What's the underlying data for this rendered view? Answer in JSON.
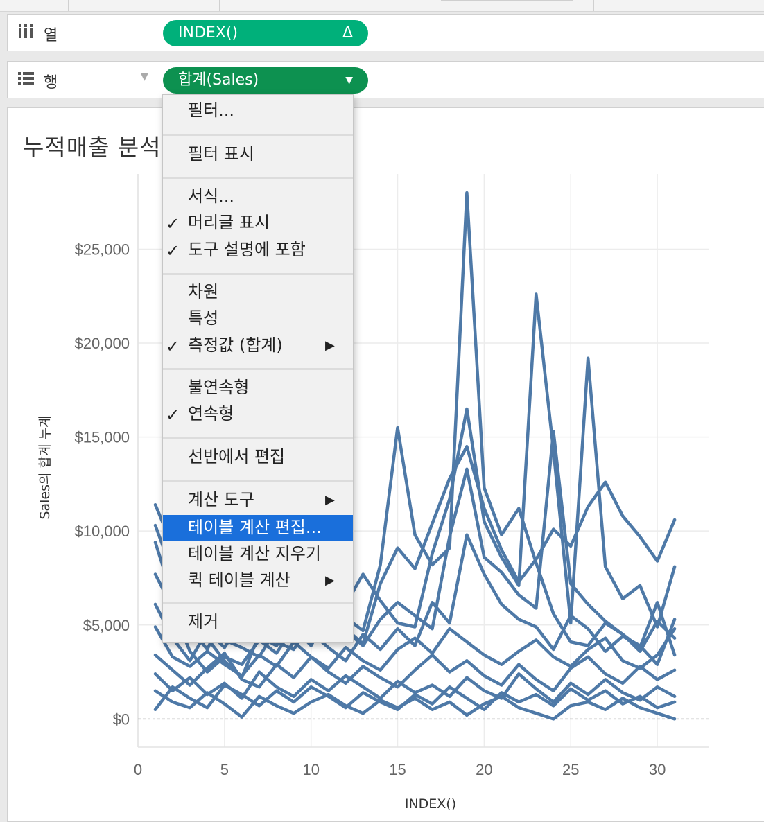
{
  "shelves": {
    "columns": {
      "label": "열",
      "pill": "INDEX()",
      "pill_symbol": "Δ",
      "icon": "columns-icon"
    },
    "rows": {
      "label": "행",
      "pill": "합계(Sales)",
      "pill_symbol": "▼",
      "icon": "rows-list-icon"
    }
  },
  "view": {
    "title": "누적매출 분석"
  },
  "menu": {
    "items": [
      {
        "label": "필터...",
        "checked": false,
        "submenu": false
      },
      {
        "label": "필터 표시",
        "checked": false,
        "submenu": false
      },
      {
        "label": "서식...",
        "checked": false,
        "submenu": false
      },
      {
        "label": "머리글 표시",
        "checked": true,
        "submenu": false
      },
      {
        "label": "도구 설명에 포함",
        "checked": true,
        "submenu": false
      },
      {
        "label": "차원",
        "checked": false,
        "submenu": false
      },
      {
        "label": "특성",
        "checked": false,
        "submenu": false
      },
      {
        "label": "측정값 (합계)",
        "checked": true,
        "submenu": true
      },
      {
        "label": "불연속형",
        "checked": false,
        "submenu": false
      },
      {
        "label": "연속형",
        "checked": true,
        "submenu": false
      },
      {
        "label": "선반에서 편집",
        "checked": false,
        "submenu": false
      },
      {
        "label": "계산 도구",
        "checked": false,
        "submenu": true
      },
      {
        "label": "테이블 계산 편집...",
        "checked": false,
        "submenu": false,
        "highlighted": true
      },
      {
        "label": "테이블 계산 지우기",
        "checked": false,
        "submenu": false
      },
      {
        "label": "퀵 테이블 계산",
        "checked": false,
        "submenu": true
      },
      {
        "label": "제거",
        "checked": false,
        "submenu": false
      }
    ],
    "check_glyph": "✓",
    "arrow_glyph": "▶"
  },
  "chart_data": {
    "type": "line",
    "title": "누적매출 분석",
    "xlabel": "INDEX()",
    "ylabel": "Sales의 합계 누계",
    "xlim": [
      0,
      33
    ],
    "ylim": [
      -1500,
      29000
    ],
    "x_ticks": [
      0,
      5,
      10,
      15,
      20,
      25,
      30
    ],
    "x_tick_labels": [
      "0",
      "5",
      "10",
      "15",
      "20",
      "25",
      "30"
    ],
    "y_ticks": [
      0,
      5000,
      10000,
      15000,
      20000,
      25000
    ],
    "y_tick_labels": [
      "$0",
      "$5,000",
      "$10,000",
      "$15,000",
      "$20,000",
      "$25,000"
    ],
    "grid": true,
    "line_color": "#4e79a7",
    "series_values": [
      [
        11400,
        9200,
        6100,
        4300,
        3100,
        2200,
        4500,
        3900,
        5200,
        6800,
        5900,
        4800,
        4000,
        7200,
        9100,
        8000,
        10400,
        12800,
        14500,
        11200,
        9000,
        7300,
        8500,
        10100,
        9200,
        11300,
        12600,
        10800,
        9700,
        8400,
        10600
      ],
      [
        10300,
        7800,
        6700,
        5100,
        4200,
        3800,
        3300,
        4800,
        6200,
        7500,
        6000,
        5400,
        4700,
        8200,
        15500,
        9800,
        8200,
        9100,
        28000,
        12300,
        9800,
        11200,
        8300,
        5600,
        4100,
        3900,
        5100,
        4500,
        3600,
        5200,
        4300
      ],
      [
        9400,
        6500,
        4900,
        3700,
        5600,
        4800,
        5300,
        4100,
        3700,
        5100,
        4600,
        6100,
        7700,
        6300,
        5100,
        4900,
        8800,
        11700,
        16500,
        10500,
        8600,
        7100,
        22600,
        14300,
        5100,
        19200,
        8100,
        6400,
        7100,
        4900,
        8100
      ],
      [
        7700,
        5900,
        3600,
        2500,
        3300,
        2900,
        4200,
        3500,
        4900,
        3900,
        5600,
        4700,
        3900,
        5300,
        6200,
        5500,
        4800,
        9700,
        13300,
        8600,
        7800,
        6600,
        5900,
        15300,
        7200,
        6100,
        5200,
        4500,
        3800,
        6200,
        3400
      ],
      [
        6100,
        4300,
        3100,
        4700,
        3800,
        5200,
        4400,
        3900,
        5700,
        4600,
        3800,
        3100,
        4500,
        3700,
        4800,
        3900,
        6200,
        5100,
        9800,
        7700,
        6100,
        5300,
        4900,
        3700,
        5500,
        4800,
        3600,
        4400,
        3900,
        2900,
        5300
      ],
      [
        4900,
        3300,
        2800,
        3600,
        2900,
        2300,
        3400,
        2800,
        4100,
        3300,
        2700,
        3800,
        3100,
        2600,
        3700,
        4300,
        3500,
        4800,
        4100,
        3400,
        2900,
        3600,
        4200,
        3300,
        2800,
        3700,
        4300,
        3100,
        2700,
        3400,
        4800
      ],
      [
        3400,
        2600,
        1800,
        2700,
        3500,
        2100,
        1700,
        2900,
        2200,
        3300,
        2500,
        1900,
        2800,
        2200,
        1700,
        2600,
        3400,
        2500,
        3100,
        2300,
        1800,
        2900,
        2100,
        1500,
        2700,
        3300,
        2400,
        1900,
        2800,
        2100,
        2600
      ],
      [
        2400,
        1500,
        2200,
        1300,
        1900,
        1100,
        2500,
        1700,
        1200,
        2100,
        1500,
        2300,
        1700,
        1100,
        2000,
        1400,
        1800,
        1200,
        2200,
        1500,
        1100,
        2400,
        1600,
        900,
        1900,
        1300,
        2100,
        1400,
        1000,
        1700,
        1200
      ],
      [
        1500,
        900,
        600,
        1400,
        800,
        100,
        1200,
        700,
        300,
        900,
        1300,
        700,
        300,
        1000,
        600,
        1100,
        500,
        900,
        200,
        800,
        1200,
        600,
        300,
        0,
        700,
        900,
        500,
        1100,
        600,
        300,
        0
      ],
      [
        500,
        1700,
        1100,
        600,
        1800,
        1300,
        700,
        1500,
        900,
        1700,
        1200,
        600,
        1400,
        900,
        500,
        1300,
        800,
        1700,
        1100,
        500,
        1400,
        900,
        1300,
        700,
        1600,
        1000,
        1500,
        800,
        1200,
        600,
        900
      ]
    ]
  }
}
